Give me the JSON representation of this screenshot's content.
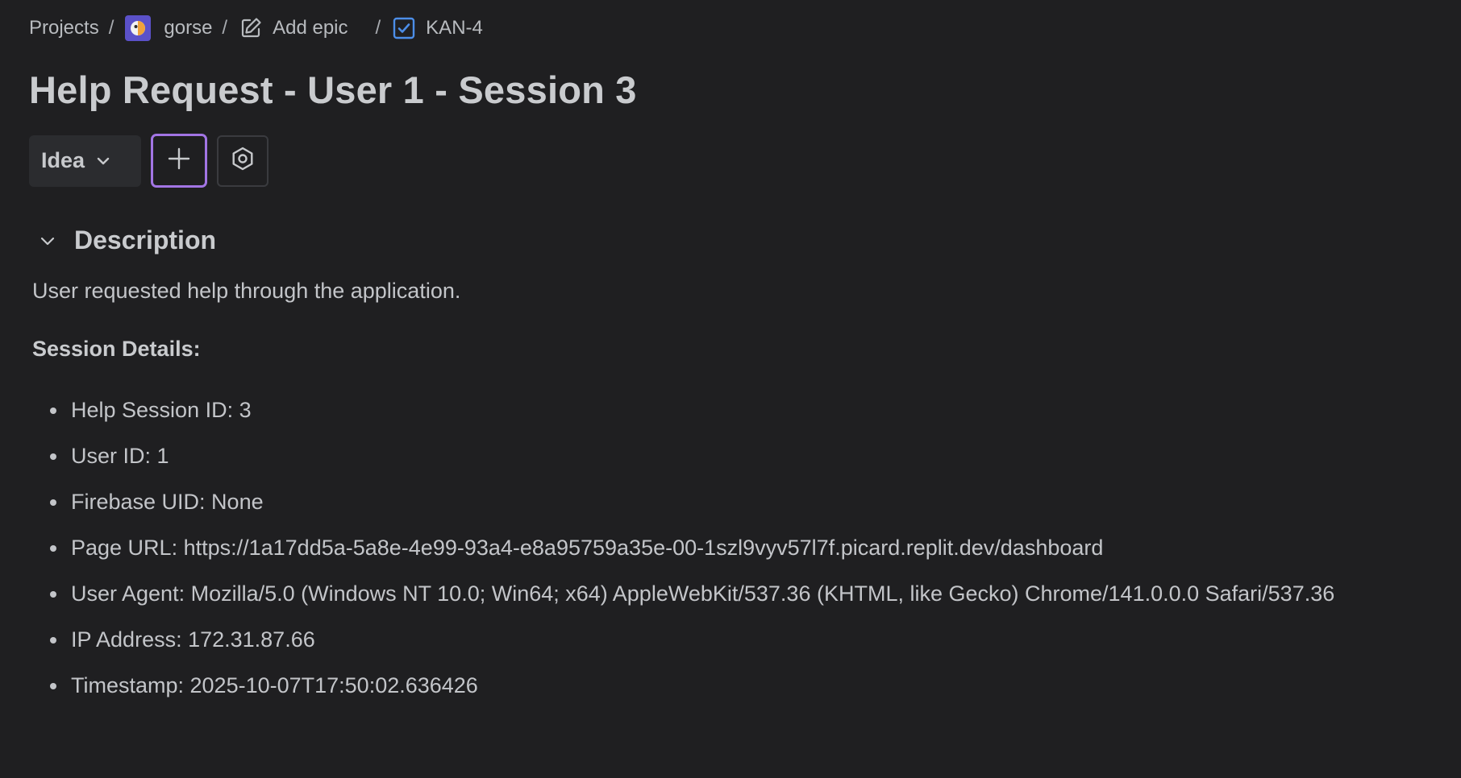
{
  "breadcrumb": {
    "projects_label": "Projects",
    "separator": "/",
    "project_name": "gorse",
    "add_epic_label": "Add epic",
    "issue_key": "KAN-4"
  },
  "issue": {
    "title": "Help Request - User 1 - Session 3",
    "status_label": "Idea"
  },
  "description": {
    "heading": "Description",
    "intro": "User requested help through the application.",
    "session_heading": "Session Details:",
    "details": [
      "Help Session ID: 3",
      "User ID: 1",
      "Firebase UID: None",
      "Page URL: https://1a17dd5a-5a8e-4e99-93a4-e8a95759a35e-00-1szl9vyv57l7f.picard.replit.dev/dashboard",
      "User Agent: Mozilla/5.0 (Windows NT 10.0; Win64; x64) AppleWebKit/537.36 (KHTML, like Gecko) Chrome/141.0.0.0 Safari/537.36",
      "IP Address: 172.31.87.66",
      "Timestamp: 2025-10-07T17:50:02.636426"
    ]
  },
  "icons": {
    "project_avatar": "parrot-avatar-icon",
    "add_epic": "edit-pencil-icon",
    "issue_type": "checkbox-task-icon",
    "status_chevron": "chevron-down-icon",
    "add": "plus-icon",
    "settings": "hexagon-settings-icon",
    "collapse": "chevron-down-icon"
  },
  "colors": {
    "background": "#1f1f21",
    "text": "#c7c9cc",
    "focus_ring": "#a275e4",
    "project_avatar": "#5b51c9",
    "task_icon": "#4c8ee8"
  }
}
